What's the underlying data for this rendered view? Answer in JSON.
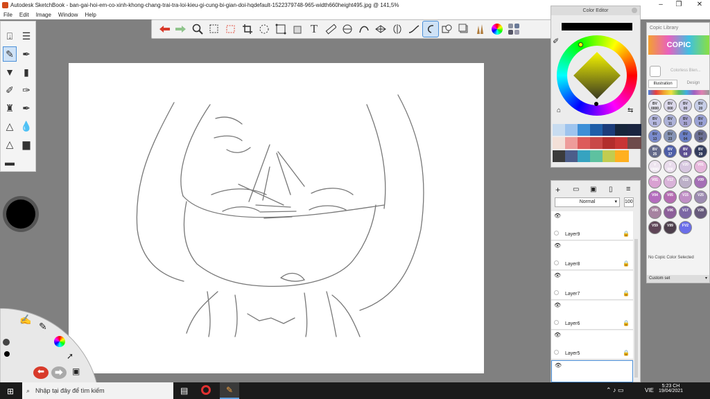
{
  "window": {
    "title": "Autodesk SketchBook - ban-gai-hoi-em-co-xinh-khong-chang-trai-tra-loi-kieu-gi-cung-bi-gian-doi-hqdefault-1522379748-965-width660height495.jpg @ 141,5%"
  },
  "menu": [
    "File",
    "Edit",
    "Image",
    "Window",
    "Help"
  ],
  "toolbar_icons": [
    "undo-icon",
    "redo-icon",
    "zoom-icon",
    "rect-select-icon",
    "lasso-select-icon",
    "crop-icon",
    "transform-icon",
    "distort-icon",
    "fill-icon",
    "text-icon",
    "ruler-icon",
    "ellipse-guide-icon",
    "french-curve-icon",
    "perspective-icon",
    "symmetry-icon",
    "steady-stroke-icon",
    "predictive-stroke-icon",
    "copy-paste-icon",
    "layer-editor-icon",
    "brush-library-icon",
    "color-wheel-icon",
    "copic-icon"
  ],
  "color_editor": {
    "title": "Color Editor",
    "swatches": [
      "#c8dcf0",
      "#9ec4ee",
      "#3d8fd7",
      "#1f5ea8",
      "#1b3c7a",
      "#17263c",
      "#1a2540",
      "#f3e0d8",
      "#ee9c9a",
      "#dd5b5b",
      "#c94848",
      "#b22d2d",
      "#c83535",
      "#6e4a4a",
      "#3b3b3b",
      "#4c5d8a",
      "#36a3c0",
      "#5ec1a0",
      "#c2cc50",
      "#ffb020"
    ]
  },
  "layers": {
    "blend_mode": "Normal",
    "opacity": "100",
    "items": [
      "Layer9",
      "Layer8",
      "Layer7",
      "Layer6",
      "Layer5"
    ]
  },
  "copic": {
    "title": "Copic Library",
    "brand": "COPIC",
    "colorless": "Colorless Blen...",
    "tabs": [
      "Illustration",
      "Design"
    ],
    "no_color": "No Copic Color Selected",
    "custom_set": "Custom set",
    "chips": [
      {
        "code": "BV\n0000",
        "color": "#e4e3ee"
      },
      {
        "code": "BV\n000",
        "color": "#dbd8ea"
      },
      {
        "code": "BV\n00",
        "color": "#cfcde6"
      },
      {
        "code": "BV\n20",
        "color": "#c6cde7"
      },
      {
        "code": "BV\n01",
        "color": "#b6b9e0"
      },
      {
        "code": "BV\n11",
        "color": "#adb2d8"
      },
      {
        "code": "BV\n31",
        "color": "#a8a6d4"
      },
      {
        "code": "BV\n02",
        "color": "#9aa2d6"
      },
      {
        "code": "BV\n13",
        "color": "#7a8bcd"
      },
      {
        "code": "BV\n23",
        "color": "#8795b6"
      },
      {
        "code": "BV\n04",
        "color": "#6a7fc5"
      },
      {
        "code": "BV\n34",
        "color": "#6d7196"
      },
      {
        "code": "BV\n25",
        "color": "#646a8a"
      },
      {
        "code": "BV\n17",
        "color": "#4e5ea8"
      },
      {
        "code": "BV\n08",
        "color": "#5d4f92"
      },
      {
        "code": "BV\n29",
        "color": "#333c5e"
      },
      {
        "code": "V\n0000",
        "color": "#ede4ef"
      },
      {
        "code": "V\n000",
        "color": "#e9dcec"
      },
      {
        "code": "V20",
        "color": "#d6c6df"
      },
      {
        "code": "V01",
        "color": "#e7b8dc"
      },
      {
        "code": "V01",
        "color": "#d9a0d2"
      },
      {
        "code": "V12",
        "color": "#d9b3d9"
      },
      {
        "code": "V22",
        "color": "#bcb0c8"
      },
      {
        "code": "V09",
        "color": "#a56fb6"
      },
      {
        "code": "V04",
        "color": "#b46dbe"
      },
      {
        "code": "V05",
        "color": "#b56db2"
      },
      {
        "code": "V15",
        "color": "#c08fc6"
      },
      {
        "code": "V25",
        "color": "#9d8cb1"
      },
      {
        "code": "V95",
        "color": "#a682a0"
      },
      {
        "code": "V06",
        "color": "#8d5f9a"
      },
      {
        "code": "V17",
        "color": "#7b66a4"
      },
      {
        "code": "V28",
        "color": "#675a7c"
      },
      {
        "code": "V59",
        "color": "#5f4557"
      },
      {
        "code": "V99",
        "color": "#4d3f4c"
      },
      {
        "code": "FV2",
        "color": "#6a6ee9"
      }
    ]
  },
  "taskbar": {
    "search_placeholder": "Nhập tại đây để tìm kiếm",
    "lang": "VIE",
    "time": "5:23 CH",
    "date": "19/04/2021"
  }
}
